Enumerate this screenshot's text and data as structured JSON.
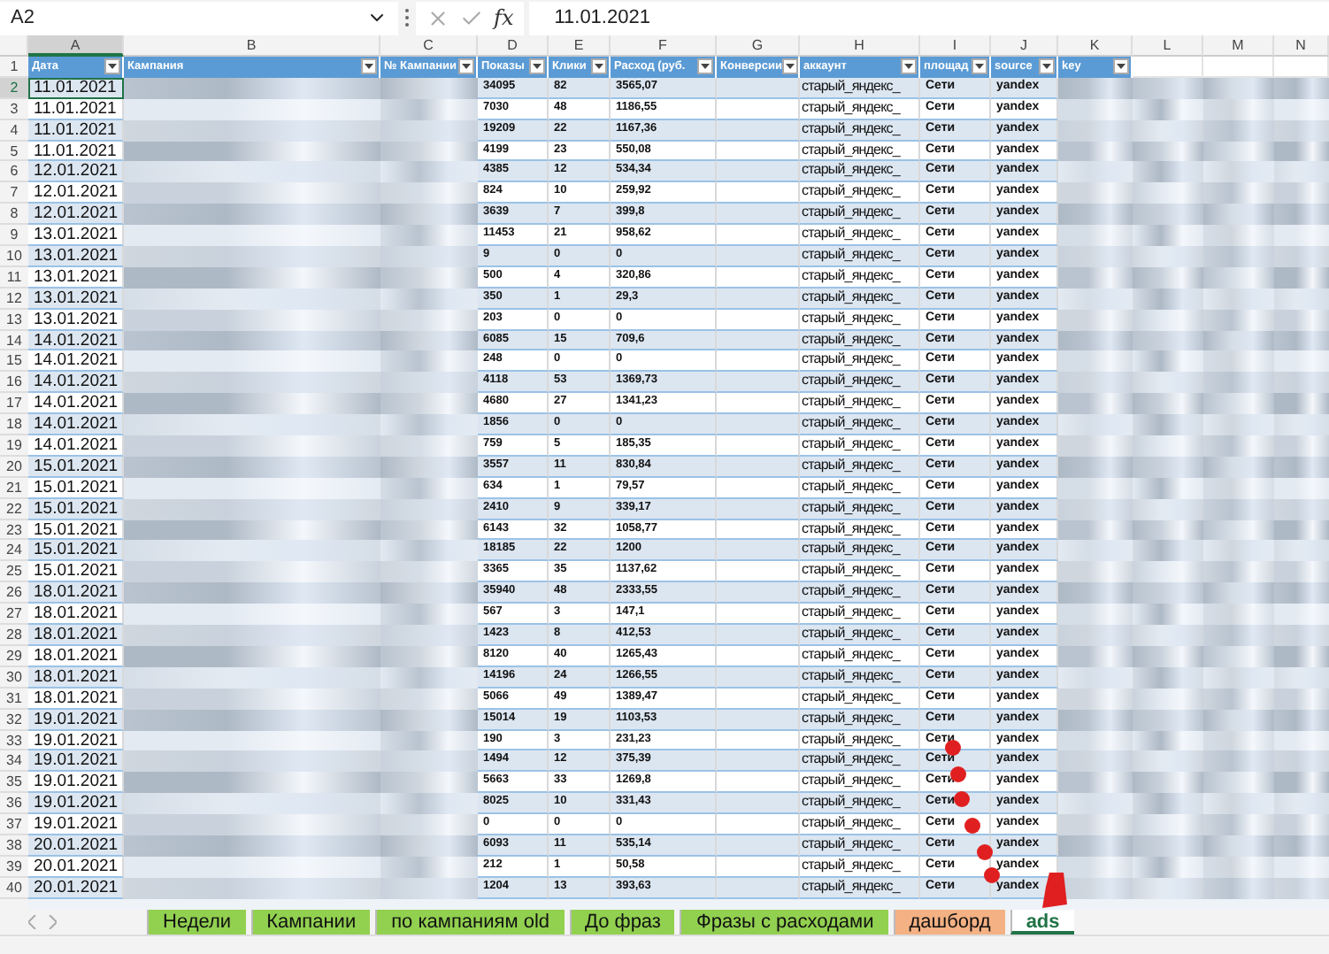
{
  "formula_bar": {
    "name_box": "A2",
    "function_label": "fx",
    "formula": "11.01.2021"
  },
  "columns": [
    "A",
    "B",
    "C",
    "D",
    "E",
    "F",
    "G",
    "H",
    "I",
    "J",
    "K",
    "L",
    "M",
    "N"
  ],
  "header": {
    "number": "1",
    "cells": [
      "Дата",
      "Кампания",
      "№ Кампании",
      "Показы",
      "Клики",
      "Расход (руб.",
      "Конверсии",
      "аккаунт",
      "площад",
      "source",
      "key"
    ]
  },
  "rows": [
    {
      "number": "2",
      "selected": true,
      "date": "11.01.2021",
      "shows": "34095",
      "clicks": "82",
      "cost": "3565,07",
      "account": "старый_яндекс_",
      "platform": "Сети",
      "source": "yandex"
    },
    {
      "number": "3",
      "selected": false,
      "date": "11.01.2021",
      "shows": "7030",
      "clicks": "48",
      "cost": "1186,55",
      "account": "старый_яндекс_",
      "platform": "Сети",
      "source": "yandex"
    },
    {
      "number": "4",
      "selected": false,
      "date": "11.01.2021",
      "shows": "19209",
      "clicks": "22",
      "cost": "1167,36",
      "account": "старый_яндекс_",
      "platform": "Сети",
      "source": "yandex"
    },
    {
      "number": "5",
      "selected": false,
      "date": "11.01.2021",
      "shows": "4199",
      "clicks": "23",
      "cost": "550,08",
      "account": "старый_яндекс_",
      "platform": "Сети",
      "source": "yandex"
    },
    {
      "number": "6",
      "selected": false,
      "date": "12.01.2021",
      "shows": "4385",
      "clicks": "12",
      "cost": "534,34",
      "account": "старый_яндекс_",
      "platform": "Сети",
      "source": "yandex"
    },
    {
      "number": "7",
      "selected": false,
      "date": "12.01.2021",
      "shows": "824",
      "clicks": "10",
      "cost": "259,92",
      "account": "старый_яндекс_",
      "platform": "Сети",
      "source": "yandex"
    },
    {
      "number": "8",
      "selected": false,
      "date": "12.01.2021",
      "shows": "3639",
      "clicks": "7",
      "cost": "399,8",
      "account": "старый_яндекс_",
      "platform": "Сети",
      "source": "yandex"
    },
    {
      "number": "9",
      "selected": false,
      "date": "13.01.2021",
      "shows": "11453",
      "clicks": "21",
      "cost": "958,62",
      "account": "старый_яндекс_",
      "platform": "Сети",
      "source": "yandex"
    },
    {
      "number": "10",
      "selected": false,
      "date": "13.01.2021",
      "shows": "9",
      "clicks": "0",
      "cost": "0",
      "account": "старый_яндекс_",
      "platform": "Сети",
      "source": "yandex"
    },
    {
      "number": "11",
      "selected": false,
      "date": "13.01.2021",
      "shows": "500",
      "clicks": "4",
      "cost": "320,86",
      "account": "старый_яндекс_",
      "platform": "Сети",
      "source": "yandex"
    },
    {
      "number": "12",
      "selected": false,
      "date": "13.01.2021",
      "shows": "350",
      "clicks": "1",
      "cost": "29,3",
      "account": "старый_яндекс_",
      "platform": "Сети",
      "source": "yandex"
    },
    {
      "number": "13",
      "selected": false,
      "date": "13.01.2021",
      "shows": "203",
      "clicks": "0",
      "cost": "0",
      "account": "старый_яндекс_",
      "platform": "Сети",
      "source": "yandex"
    },
    {
      "number": "14",
      "selected": false,
      "date": "14.01.2021",
      "shows": "6085",
      "clicks": "15",
      "cost": "709,6",
      "account": "старый_яндекс_",
      "platform": "Сети",
      "source": "yandex"
    },
    {
      "number": "15",
      "selected": false,
      "date": "14.01.2021",
      "shows": "248",
      "clicks": "0",
      "cost": "0",
      "account": "старый_яндекс_",
      "platform": "Сети",
      "source": "yandex"
    },
    {
      "number": "16",
      "selected": false,
      "date": "14.01.2021",
      "shows": "4118",
      "clicks": "53",
      "cost": "1369,73",
      "account": "старый_яндекс_",
      "platform": "Сети",
      "source": "yandex"
    },
    {
      "number": "17",
      "selected": false,
      "date": "14.01.2021",
      "shows": "4680",
      "clicks": "27",
      "cost": "1341,23",
      "account": "старый_яндекс_",
      "platform": "Сети",
      "source": "yandex"
    },
    {
      "number": "18",
      "selected": false,
      "date": "14.01.2021",
      "shows": "1856",
      "clicks": "0",
      "cost": "0",
      "account": "старый_яндекс_",
      "platform": "Сети",
      "source": "yandex"
    },
    {
      "number": "19",
      "selected": false,
      "date": "14.01.2021",
      "shows": "759",
      "clicks": "5",
      "cost": "185,35",
      "account": "старый_яндекс_",
      "platform": "Сети",
      "source": "yandex"
    },
    {
      "number": "20",
      "selected": false,
      "date": "15.01.2021",
      "shows": "3557",
      "clicks": "11",
      "cost": "830,84",
      "account": "старый_яндекс_",
      "platform": "Сети",
      "source": "yandex"
    },
    {
      "number": "21",
      "selected": false,
      "date": "15.01.2021",
      "shows": "634",
      "clicks": "1",
      "cost": "79,57",
      "account": "старый_яндекс_",
      "platform": "Сети",
      "source": "yandex"
    },
    {
      "number": "22",
      "selected": false,
      "date": "15.01.2021",
      "shows": "2410",
      "clicks": "9",
      "cost": "339,17",
      "account": "старый_яндекс_",
      "platform": "Сети",
      "source": "yandex"
    },
    {
      "number": "23",
      "selected": false,
      "date": "15.01.2021",
      "shows": "6143",
      "clicks": "32",
      "cost": "1058,77",
      "account": "старый_яндекс_",
      "platform": "Сети",
      "source": "yandex"
    },
    {
      "number": "24",
      "selected": false,
      "date": "15.01.2021",
      "shows": "18185",
      "clicks": "22",
      "cost": "1200",
      "account": "старый_яндекс_",
      "platform": "Сети",
      "source": "yandex"
    },
    {
      "number": "25",
      "selected": false,
      "date": "15.01.2021",
      "shows": "3365",
      "clicks": "35",
      "cost": "1137,62",
      "account": "старый_яндекс_",
      "platform": "Сети",
      "source": "yandex"
    },
    {
      "number": "26",
      "selected": false,
      "date": "18.01.2021",
      "shows": "35940",
      "clicks": "48",
      "cost": "2333,55",
      "account": "старый_яндекс_",
      "platform": "Сети",
      "source": "yandex"
    },
    {
      "number": "27",
      "selected": false,
      "date": "18.01.2021",
      "shows": "567",
      "clicks": "3",
      "cost": "147,1",
      "account": "старый_яндекс_",
      "platform": "Сети",
      "source": "yandex"
    },
    {
      "number": "28",
      "selected": false,
      "date": "18.01.2021",
      "shows": "1423",
      "clicks": "8",
      "cost": "412,53",
      "account": "старый_яндекс_",
      "platform": "Сети",
      "source": "yandex"
    },
    {
      "number": "29",
      "selected": false,
      "date": "18.01.2021",
      "shows": "8120",
      "clicks": "40",
      "cost": "1265,43",
      "account": "старый_яндекс_",
      "platform": "Сети",
      "source": "yandex"
    },
    {
      "number": "30",
      "selected": false,
      "date": "18.01.2021",
      "shows": "14196",
      "clicks": "24",
      "cost": "1266,55",
      "account": "старый_яндекс_",
      "platform": "Сети",
      "source": "yandex"
    },
    {
      "number": "31",
      "selected": false,
      "date": "18.01.2021",
      "shows": "5066",
      "clicks": "49",
      "cost": "1389,47",
      "account": "старый_яндекс_",
      "platform": "Сети",
      "source": "yandex"
    },
    {
      "number": "32",
      "selected": false,
      "date": "19.01.2021",
      "shows": "15014",
      "clicks": "19",
      "cost": "1103,53",
      "account": "старый_яндекс_",
      "platform": "Сети",
      "source": "yandex"
    },
    {
      "number": "33",
      "selected": false,
      "date": "19.01.2021",
      "shows": "190",
      "clicks": "3",
      "cost": "231,23",
      "account": "старый_яндекс_",
      "platform": "Сети",
      "source": "yandex"
    },
    {
      "number": "34",
      "selected": false,
      "date": "19.01.2021",
      "shows": "1494",
      "clicks": "12",
      "cost": "375,39",
      "account": "старый_яндекс_",
      "platform": "Сети",
      "source": "yandex"
    },
    {
      "number": "35",
      "selected": false,
      "date": "19.01.2021",
      "shows": "5663",
      "clicks": "33",
      "cost": "1269,8",
      "account": "старый_яндекс_",
      "platform": "Сети",
      "source": "yandex"
    },
    {
      "number": "36",
      "selected": false,
      "date": "19.01.2021",
      "shows": "8025",
      "clicks": "10",
      "cost": "331,43",
      "account": "старый_яндекс_",
      "platform": "Сети",
      "source": "yandex"
    },
    {
      "number": "37",
      "selected": false,
      "date": "19.01.2021",
      "shows": "0",
      "clicks": "0",
      "cost": "0",
      "account": "старый_яндекс_",
      "platform": "Сети",
      "source": "yandex"
    },
    {
      "number": "38",
      "selected": false,
      "date": "20.01.2021",
      "shows": "6093",
      "clicks": "11",
      "cost": "535,14",
      "account": "старый_яндекс_",
      "platform": "Сети",
      "source": "yandex"
    },
    {
      "number": "39",
      "selected": false,
      "date": "20.01.2021",
      "shows": "212",
      "clicks": "1",
      "cost": "50,58",
      "account": "старый_яндекс_",
      "platform": "Сети",
      "source": "yandex"
    },
    {
      "number": "40",
      "selected": false,
      "date": "20.01.2021",
      "shows": "1204",
      "clicks": "13",
      "cost": "393,63",
      "account": "старый_яндекс_",
      "platform": "Сети",
      "source": "yandex"
    }
  ],
  "sheet_tabs": [
    {
      "label": "Недели",
      "color": "#92d050",
      "selected": false
    },
    {
      "label": "Кампании",
      "color": "#92d050",
      "selected": false
    },
    {
      "label": "по кампаниям old",
      "color": "#92d050",
      "selected": false
    },
    {
      "label": "До фраз",
      "color": "#92d050",
      "selected": false
    },
    {
      "label": "Фразы с расходами",
      "color": "#92d050",
      "selected": false
    },
    {
      "label": "дашборд",
      "color": "#f4b183",
      "selected": false
    },
    {
      "label": "ads",
      "color": "#ffffff",
      "selected": true
    }
  ]
}
